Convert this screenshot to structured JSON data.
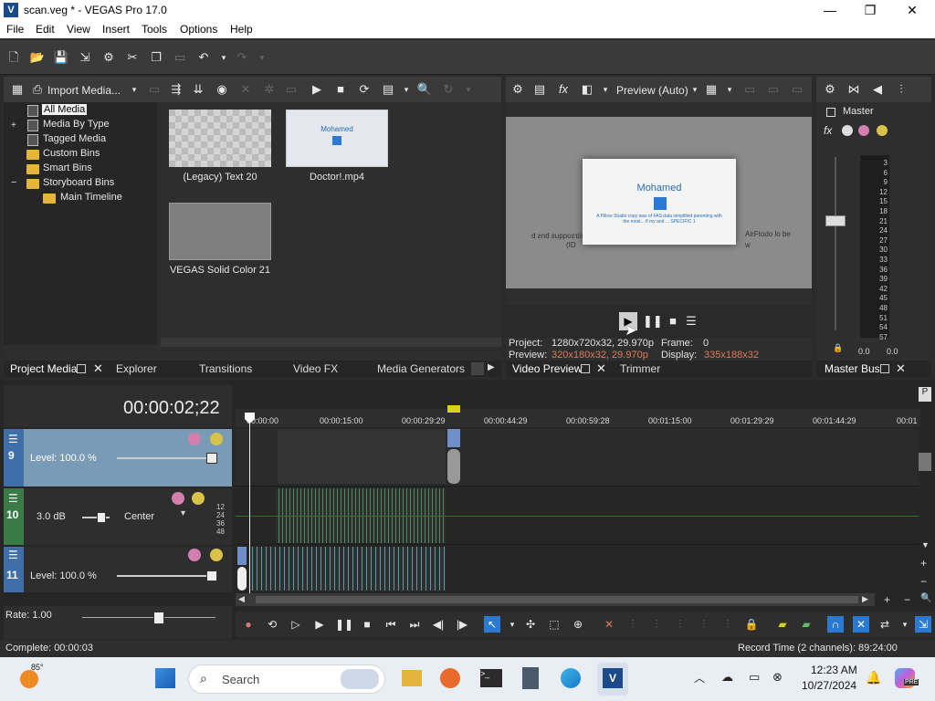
{
  "window": {
    "title": "scan.veg * - VEGAS Pro 17.0",
    "app_icon_letter": "V",
    "minimize": "—",
    "maximize": "❐",
    "close": "✕"
  },
  "menu": [
    "File",
    "Edit",
    "View",
    "Insert",
    "Tools",
    "Options",
    "Help"
  ],
  "project_media": {
    "import_label": "Import Media...",
    "tree": [
      {
        "label": "All Media",
        "selected": true
      },
      {
        "label": "Media By Type"
      },
      {
        "label": "Tagged Media"
      },
      {
        "label": "Custom Bins"
      },
      {
        "label": "Smart Bins"
      },
      {
        "label": "Storyboard Bins"
      },
      {
        "label": "Main Timeline"
      }
    ],
    "tree_expanders": [
      "+",
      "−"
    ],
    "thumbs": [
      {
        "label": "(Legacy) Text 20"
      },
      {
        "label": "Doctor!.mp4",
        "thumb_title": "Mohamed"
      },
      {
        "label": "VEGAS Solid Color 21"
      }
    ],
    "tabs": [
      "Project Media",
      "Explorer",
      "Transitions",
      "Video FX",
      "Media Generators"
    ]
  },
  "preview": {
    "mode_label": "Preview (Auto)",
    "frame_title": "Mohamed",
    "frame_subtitle": "A Pillow Studio copy was of FAS data simplified parenting with the most... fl my and ... SPECIFIC 1",
    "bg_text_left": "gnitrsoqqus bns b",
    "bg_text_left2": "(ID",
    "bg_text_right": "AirFtodo lo be",
    "bg_text_right2": "w",
    "project_label": "Project:",
    "project_value": "1280x720x32, 29.970p",
    "preview_label": "Preview:",
    "preview_value": "320x180x32, 29.970p",
    "frame_label": "Frame:",
    "frame_value": "0",
    "display_label": "Display:",
    "display_value": "335x188x32",
    "tabs": [
      "Video Preview",
      "Trimmer"
    ]
  },
  "master": {
    "label": "Master",
    "fx": "fx",
    "scale": [
      "3",
      "6",
      "9",
      "12",
      "15",
      "18",
      "21",
      "24",
      "27",
      "30",
      "33",
      "36",
      "39",
      "42",
      "45",
      "48",
      "51",
      "54",
      "57"
    ],
    "left_value": "0.0",
    "right_value": "0.0",
    "tab": "Master Bus"
  },
  "timeline": {
    "timecode": "00:00:02;22",
    "ruler": [
      "00:00:00",
      "00:00:15:00",
      "00:00:29:29",
      "00:00:44:29",
      "00:00:59:28",
      "00:01:15:00",
      "00:01:29:29",
      "00:01:44:29",
      "00:01"
    ],
    "tracks": [
      {
        "num": "9",
        "label": "Level: 100.0 %"
      },
      {
        "num": "10",
        "volume": "3.0 dB",
        "pan": "Center",
        "meter": [
          "12",
          "24",
          "36",
          "48"
        ]
      },
      {
        "num": "11",
        "label": "Level: 100.0 %"
      }
    ],
    "rate": "Rate: 1.00"
  },
  "status": {
    "left": "Complete: 00:00:03",
    "right": "Record Time (2 channels): 89:24:00"
  },
  "taskbar": {
    "weather": "85°",
    "search": "Search",
    "time": "12:23 AM",
    "date": "10/27/2024",
    "copilot_badge": "PRE"
  },
  "colors": {
    "accent_blue": "#2a7ad2",
    "track_selected": "#7a9bb5",
    "panel_bg": "#2e2e2e",
    "taskbar_bg": "#e9eef5"
  }
}
